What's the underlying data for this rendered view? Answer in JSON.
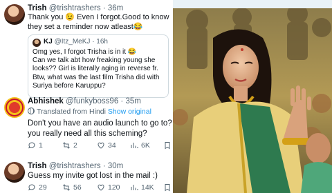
{
  "reply1": {
    "name": "Trish",
    "handle": "@trishtrashers",
    "time": "· 36m",
    "text_line1": "Thank you 😉 Even I forgot.Good to know",
    "text_line2": "they set a reminder now atleast😂"
  },
  "quoted": {
    "name": "KJ",
    "handle": "@Itz_MeKJ",
    "time": "· 16h",
    "lines": [
      "Omg yes, I forgot Trisha is in it 😂",
      "Can we talk abt how freaking young she",
      "looks?? Girl is literally aging in reverse fr.",
      "Btw, what was the last film Trisha did with",
      "Suriya before Karuppu?"
    ]
  },
  "reply2": {
    "name": "Abhishek",
    "handle": "@funkyboss96",
    "time": "· 35m",
    "translated_label": "Translated from Hindi",
    "show_original": "Show original",
    "text_line1": "Don't you have an audio launch to go to?",
    "text_line2": "you really need all this scheming?",
    "actions": {
      "replies": "1",
      "reposts": "2",
      "likes": "34",
      "views": "6K"
    }
  },
  "reply3": {
    "name": "Trish",
    "handle": "@trishtrashers",
    "time": "· 30m",
    "text_line1": "Guess my invite got lost in the mail :)",
    "actions": {
      "replies": "29",
      "reposts": "56",
      "likes": "120",
      "views": "14K"
    }
  },
  "icons": {
    "reply": "reply-icon",
    "repost": "repost-icon",
    "like": "like-icon",
    "views": "views-icon",
    "bookmark": "bookmark-icon"
  },
  "colors": {
    "link": "#1d9bf0",
    "muted": "#536471",
    "border": "#cfd9de"
  }
}
